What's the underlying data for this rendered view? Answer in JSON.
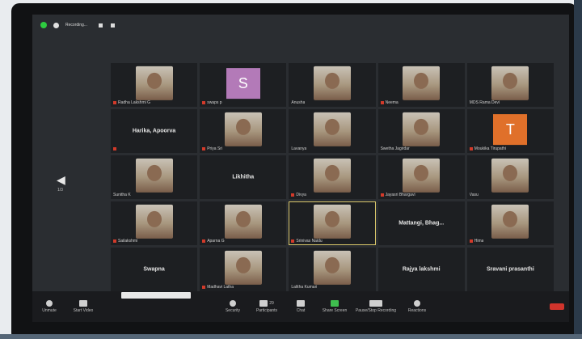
{
  "topbar": {
    "recording_label": "Recording..."
  },
  "navigation": {
    "page_indicator": "1/3"
  },
  "participants": [
    {
      "name": "Radha Lakshmi G",
      "video": true,
      "muted": true
    },
    {
      "name": "swaps p",
      "video": false,
      "initial": "S",
      "color": "#b37ab8",
      "muted": true
    },
    {
      "name": "Anusha",
      "video": true,
      "muted": false
    },
    {
      "name": "Neema",
      "video": true,
      "muted": true
    },
    {
      "name": "MDS Rama Devi",
      "video": true,
      "muted": false
    },
    {
      "name": "",
      "video": false,
      "center_label": "Harika, Apoorva",
      "muted": true
    },
    {
      "name": "Priya Sri",
      "video": true,
      "muted": true
    },
    {
      "name": "Lavanya",
      "video": true,
      "muted": false
    },
    {
      "name": "Swetha Jagirdar",
      "video": true,
      "muted": false
    },
    {
      "name": "Moukika Tirupathi",
      "video": false,
      "initial": "T",
      "color": "#e0702a",
      "muted": true
    },
    {
      "name": "Sunitha K",
      "video": true,
      "muted": false
    },
    {
      "name": "",
      "video": false,
      "center_label": "Likhitha",
      "muted": false
    },
    {
      "name": "Divya",
      "video": true,
      "muted": true
    },
    {
      "name": "Jayasri Bhargavi",
      "video": true,
      "muted": true
    },
    {
      "name": "Vasu",
      "video": true,
      "muted": false
    },
    {
      "name": "Sailakshmi",
      "video": true,
      "muted": true
    },
    {
      "name": "Aparna G",
      "video": true,
      "muted": true
    },
    {
      "name": "Srinivas Naidu",
      "video": true,
      "muted": true,
      "active": true
    },
    {
      "name": "",
      "video": false,
      "center_label": "Mattangi, Bhag...",
      "muted": false
    },
    {
      "name": "Hima",
      "video": true,
      "muted": true
    },
    {
      "name": "",
      "video": false,
      "center_label": "Swapna",
      "muted": false
    },
    {
      "name": "Madhavi Latha",
      "video": true,
      "muted": true
    },
    {
      "name": "Lalitha Kumari",
      "video": true,
      "muted": false
    },
    {
      "name": "",
      "video": false,
      "center_label": "Rajya lakshmi",
      "muted": false
    },
    {
      "name": "",
      "video": false,
      "center_label": "Sravani prasanthi",
      "muted": false
    }
  ],
  "toolbar": {
    "unmute": "Unmute",
    "start_video": "Start Video",
    "security": "Security",
    "participants": "Participants",
    "participants_count": "29",
    "chat": "Chat",
    "share_screen": "Share Screen",
    "pause_recording": "Pause/Stop Recording",
    "reactions": "Reactions"
  }
}
